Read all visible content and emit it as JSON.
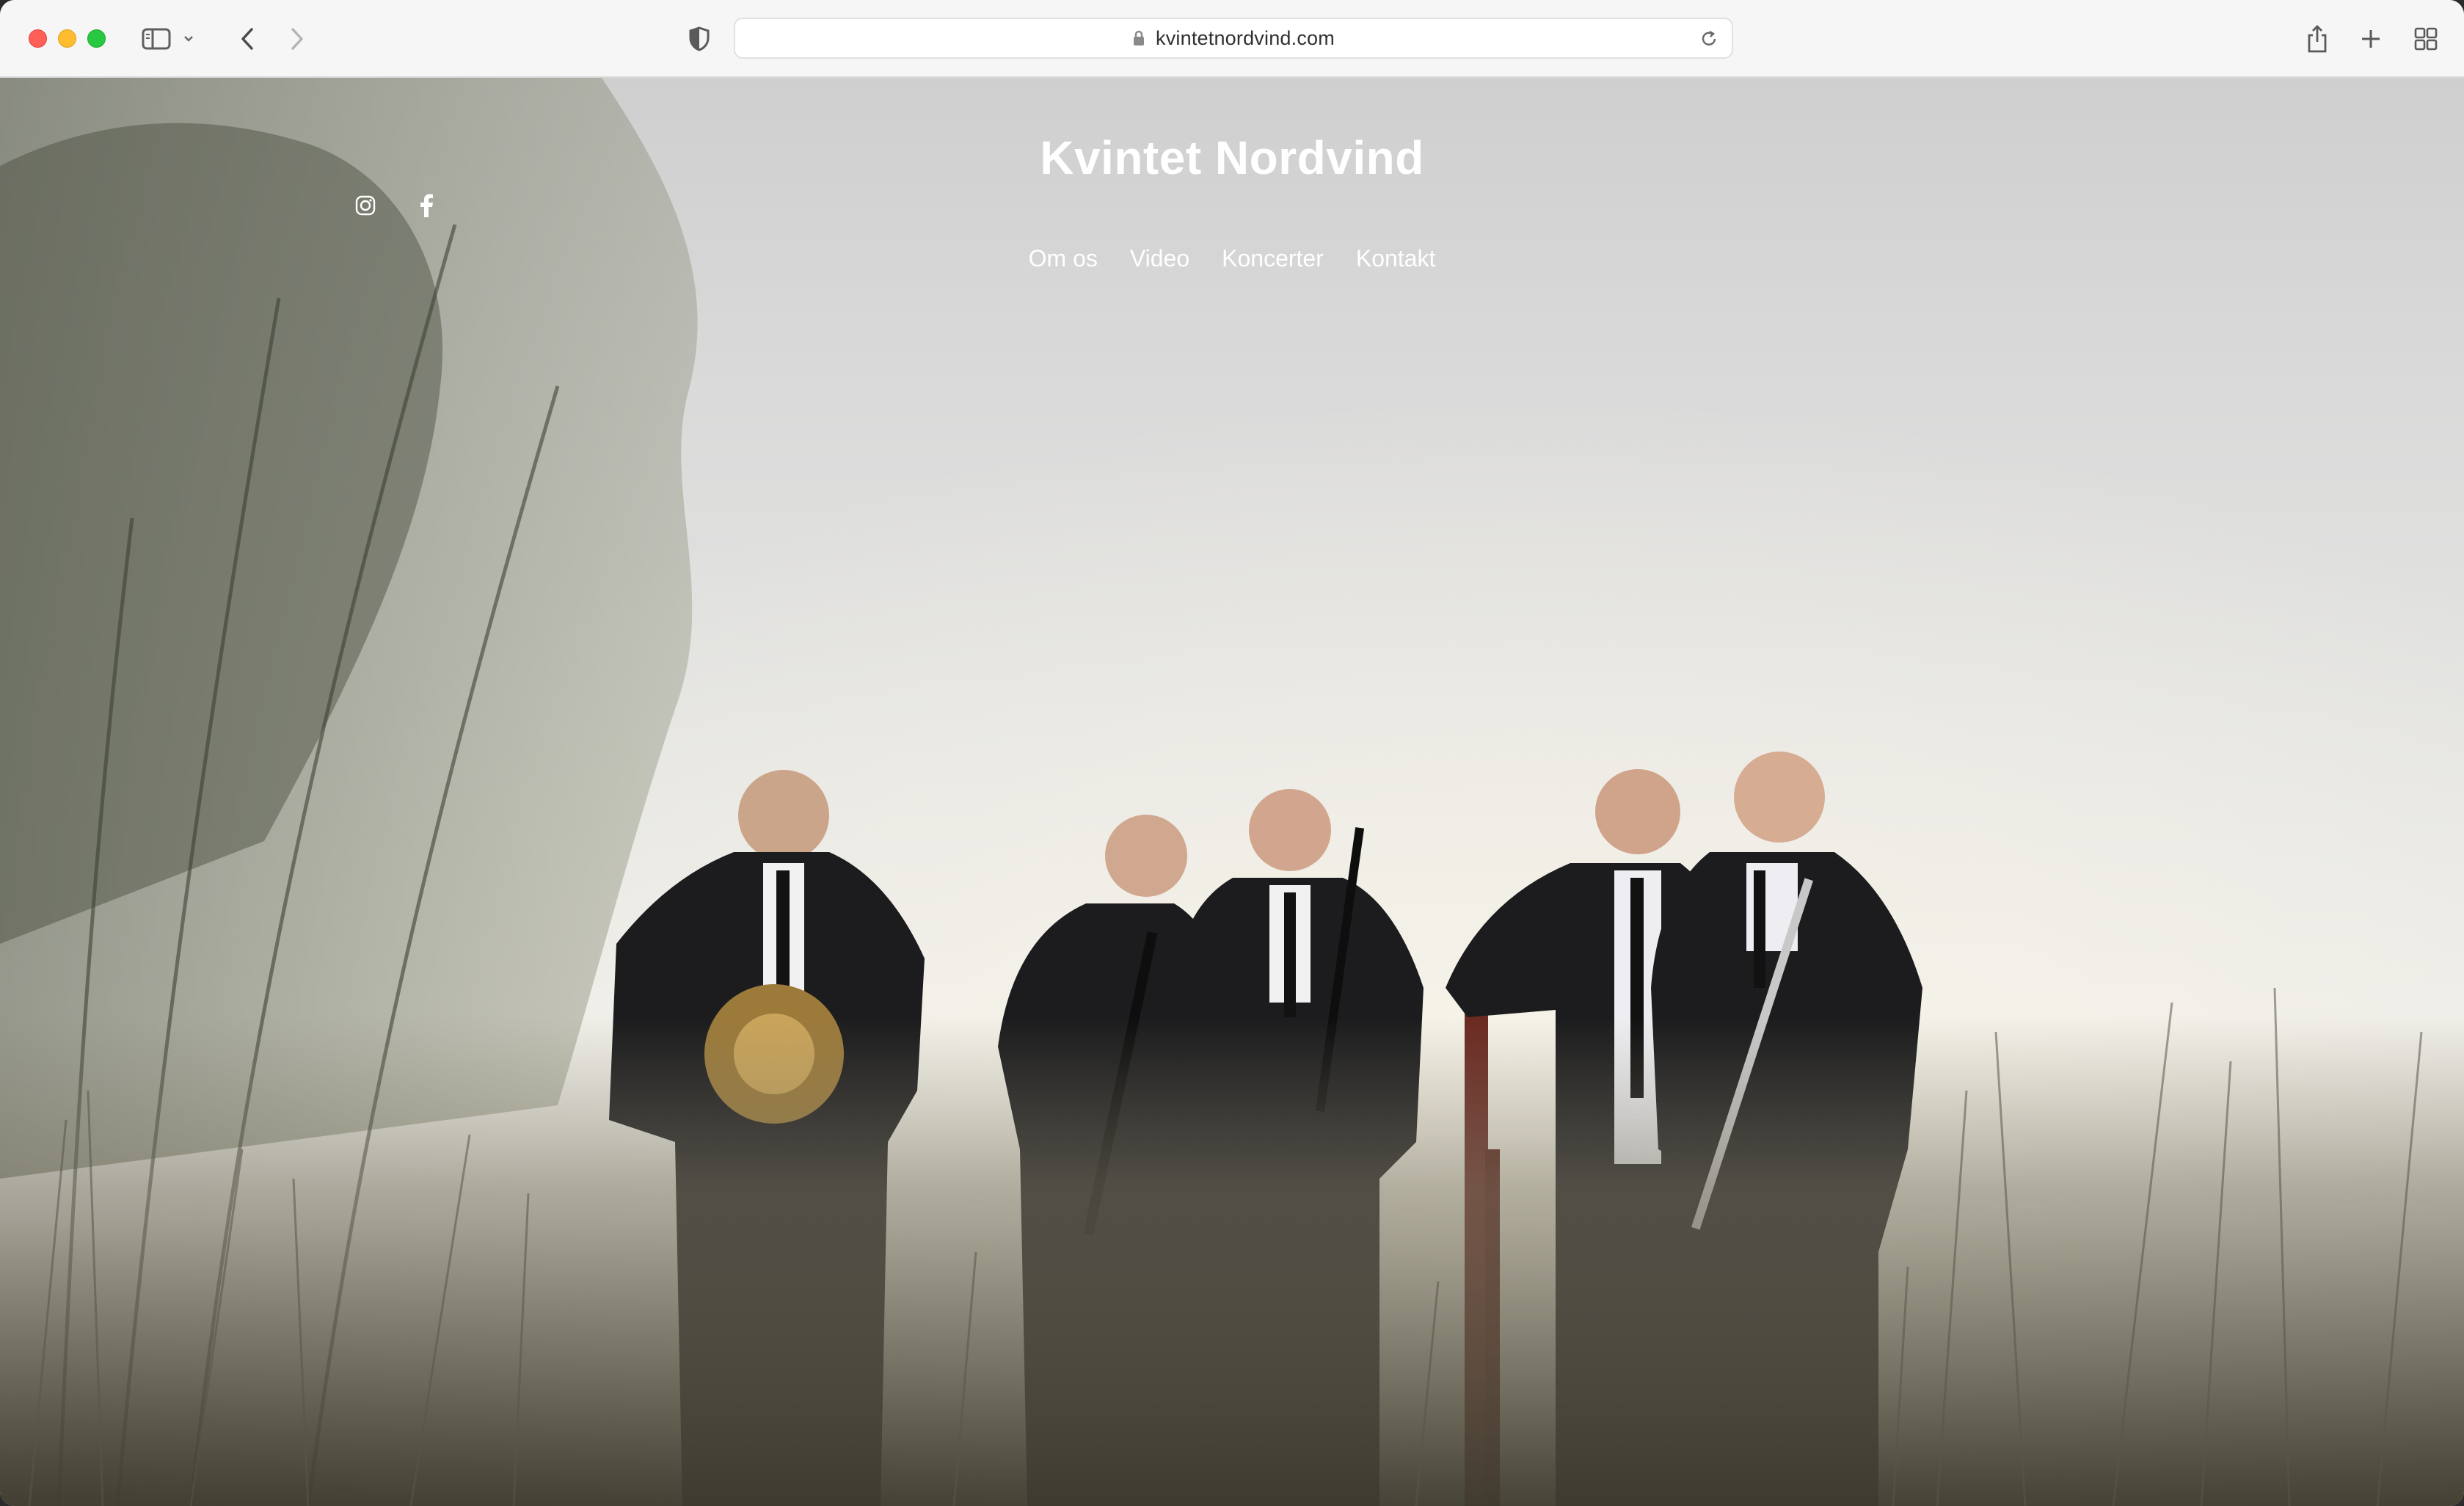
{
  "browser": {
    "url": "kvintetnordvind.com"
  },
  "site": {
    "title": "Kvintet Nordvind",
    "nav": [
      {
        "label": "Om os"
      },
      {
        "label": "Video"
      },
      {
        "label": "Koncerter"
      },
      {
        "label": "Kontakt"
      }
    ],
    "social_icons": [
      "instagram-icon",
      "facebook-icon"
    ]
  },
  "colors": {
    "traffic_red": "#fe5f57",
    "traffic_yellow": "#febc2e",
    "traffic_green": "#28c840",
    "nav_text": "#ffffff"
  }
}
